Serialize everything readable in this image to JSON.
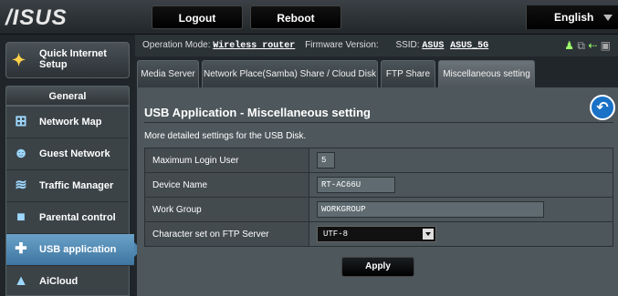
{
  "header": {
    "logo": "/ISUS",
    "logout": "Logout",
    "reboot": "Reboot",
    "language": "English"
  },
  "sidebar": {
    "quick_setup": "Quick Internet Setup",
    "general": "General",
    "items": [
      {
        "label": "Network Map",
        "icon": "network-map-icon"
      },
      {
        "label": "Guest Network",
        "icon": "guest-network-icon"
      },
      {
        "label": "Traffic Manager",
        "icon": "traffic-manager-icon"
      },
      {
        "label": "Parental control",
        "icon": "parental-control-icon"
      },
      {
        "label": "USB application",
        "icon": "usb-application-icon",
        "active": true
      },
      {
        "label": "AiCloud",
        "icon": "aicloud-icon"
      }
    ]
  },
  "status": {
    "mode_label": "Operation Mode:",
    "mode_value": "Wireless router",
    "fw_label": "Firmware Version:",
    "ssid_label": "SSID:",
    "ssid1": "ASUS",
    "ssid2": "ASUS_5G"
  },
  "tabs": [
    {
      "label": "Media Server"
    },
    {
      "label": "Network Place(Samba) Share / Cloud Disk"
    },
    {
      "label": "FTP Share"
    },
    {
      "label": "Miscellaneous setting",
      "active": true
    }
  ],
  "main": {
    "title": "USB Application - Miscellaneous setting",
    "desc": "More detailed settings for the USB Disk.",
    "rows": [
      {
        "label": "Maximum Login User",
        "value": "5"
      },
      {
        "label": "Device Name",
        "value": "RT-AC66U"
      },
      {
        "label": "Work Group",
        "value": "WORKGROUP"
      },
      {
        "label": "Character set on FTP Server",
        "value": "UTF-8"
      }
    ],
    "apply": "Apply"
  }
}
